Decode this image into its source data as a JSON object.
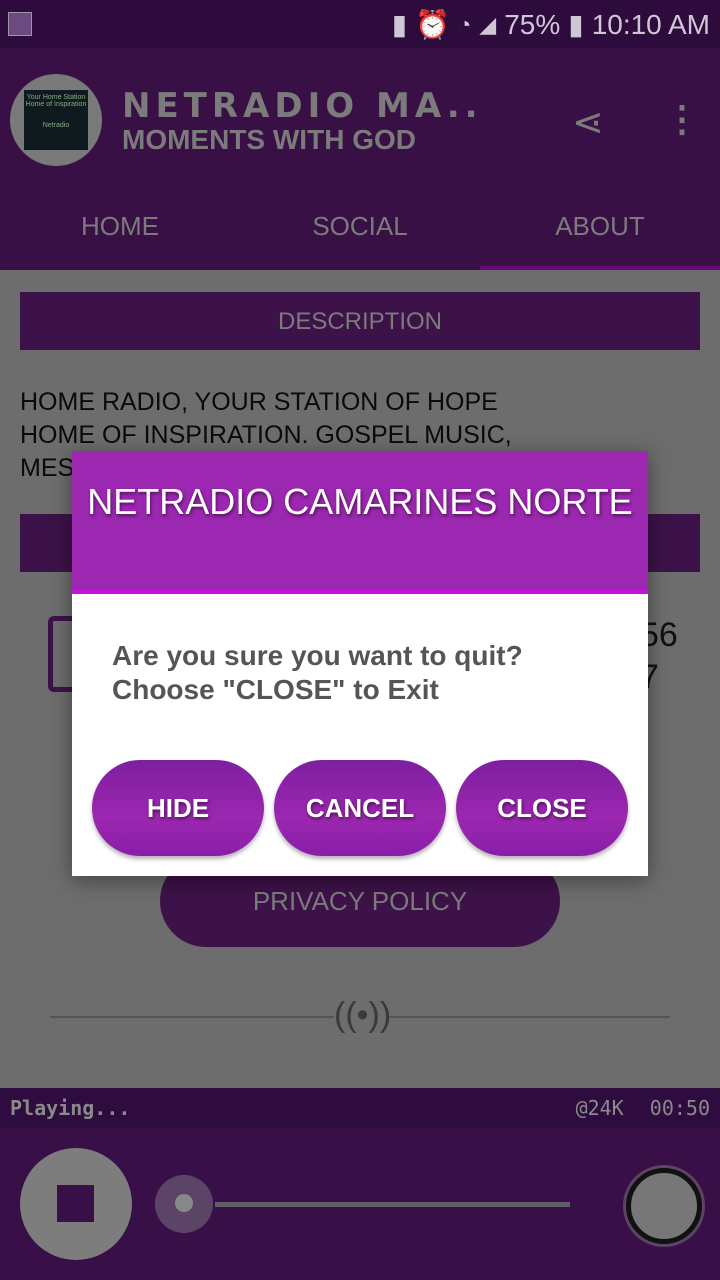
{
  "status_bar": {
    "battery": "75%",
    "time": "10:10 AM"
  },
  "header": {
    "title": "NETRADIO MA..",
    "subtitle": "MOMENTS WITH GOD",
    "logo_text": "Your Home Station Home of Inspiration Netradio"
  },
  "tabs": [
    {
      "label": "HOME"
    },
    {
      "label": "SOCIAL"
    },
    {
      "label": "ABOUT",
      "active": true
    }
  ],
  "about": {
    "description_header": "DESCRIPTION",
    "description_lines": [
      "HOME RADIO, YOUR STATION OF HOPE",
      "HOME OF INSPIRATION. GOSPEL MUSIC,",
      "MES"
    ],
    "phone_partial": [
      "56",
      "7"
    ],
    "privacy_label": "PRIVACY POLICY"
  },
  "player": {
    "status": "Playing...",
    "bitrate": "@24K",
    "elapsed": "00:50"
  },
  "dialog": {
    "title": "NETRADIO CAMARINES NORTE",
    "message_lines": [
      "Are you sure you want to quit?",
      "Choose \"CLOSE\" to Exit"
    ],
    "buttons": [
      "HIDE",
      "CANCEL",
      "CLOSE"
    ]
  },
  "colors": {
    "dialog_header": "#9c27b0",
    "toolbar": "#381045",
    "accent": "#c912d8"
  }
}
